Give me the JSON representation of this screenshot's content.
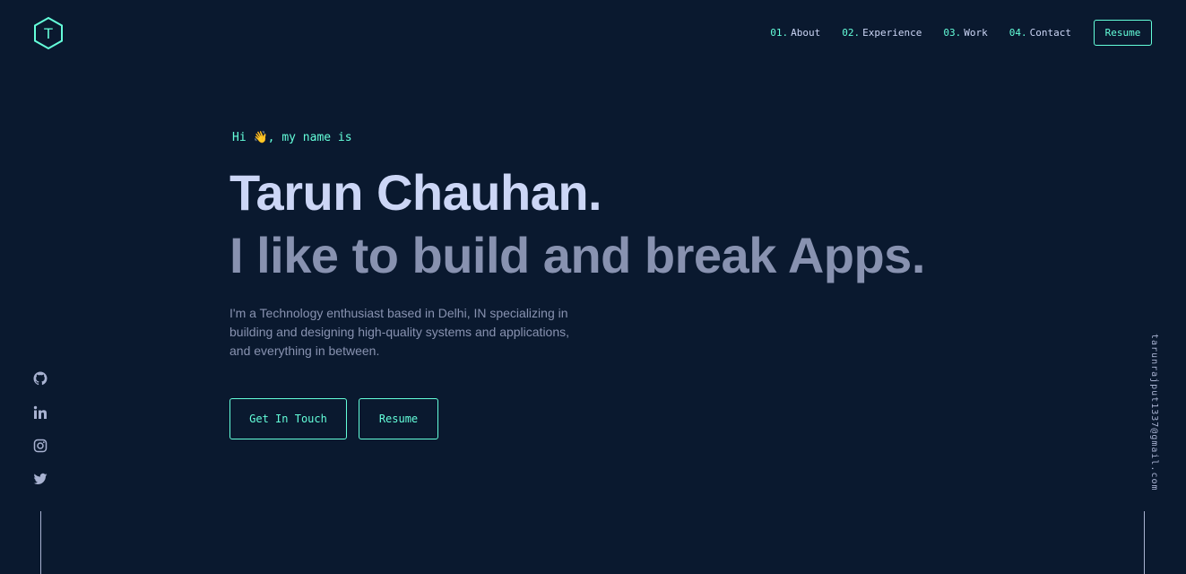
{
  "logo": {
    "letter": "T",
    "icon": "hexagon-logo-icon",
    "color": "#64ffda"
  },
  "nav": {
    "items": [
      {
        "num": "01.",
        "label": "About"
      },
      {
        "num": "02.",
        "label": "Experience"
      },
      {
        "num": "03.",
        "label": "Work"
      },
      {
        "num": "04.",
        "label": "Contact"
      }
    ],
    "resume_label": "Resume"
  },
  "hero": {
    "greeting": "Hi 👋, my name is",
    "name": "Tarun Chauhan.",
    "tagline": "I like to build and break Apps.",
    "bio": "I'm a Technology enthusiast based in Delhi, IN specializing in building and designing high-quality systems and applications, and everything in between.",
    "cta_primary": "Get In Touch",
    "cta_secondary": "Resume"
  },
  "social": [
    "github-icon",
    "linkedin-icon",
    "instagram-icon",
    "twitter-icon"
  ],
  "email": "tarunrajput1337@gmail.com",
  "colors": {
    "background": "#0a192f",
    "accent": "#64ffda",
    "heading": "#ccd6f6",
    "text": "#8892b0"
  }
}
